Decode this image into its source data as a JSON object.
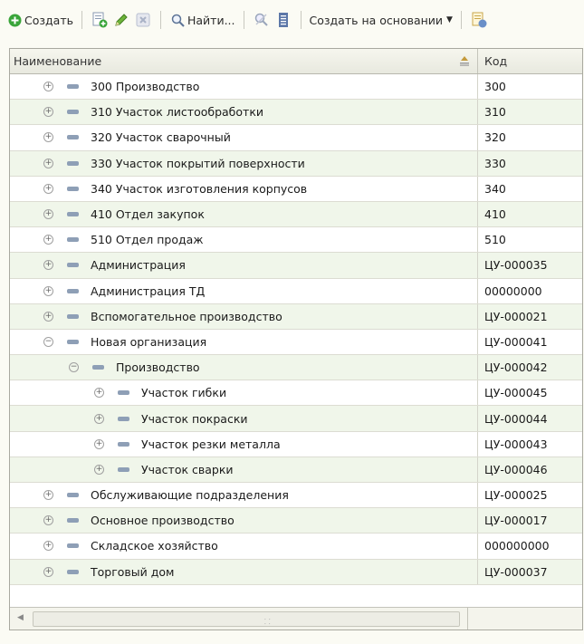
{
  "toolbar": {
    "create_label": "Создать",
    "find_label": "Найти...",
    "create_based_label": "Создать на основании"
  },
  "colors": {
    "accent_green": "#3aa53a",
    "row_alt": "#f0f6ea",
    "folder": "#8e9fb6"
  },
  "table": {
    "columns": {
      "name": "Наименование",
      "code": "Код"
    },
    "rows": [
      {
        "name": "300 Производство",
        "code": "300",
        "level": 0,
        "state": "collapsed"
      },
      {
        "name": "310 Участок листообработки",
        "code": "310",
        "level": 0,
        "state": "collapsed"
      },
      {
        "name": "320 Участок сварочный",
        "code": "320",
        "level": 0,
        "state": "collapsed"
      },
      {
        "name": "330 Участок покрытий поверхности",
        "code": "330",
        "level": 0,
        "state": "collapsed"
      },
      {
        "name": "340 Участок изготовления корпусов",
        "code": "340",
        "level": 0,
        "state": "collapsed"
      },
      {
        "name": "410 Отдел закупок",
        "code": "410",
        "level": 0,
        "state": "collapsed"
      },
      {
        "name": "510 Отдел продаж",
        "code": "510",
        "level": 0,
        "state": "collapsed"
      },
      {
        "name": "Администрация",
        "code": "ЦУ-000035",
        "level": 0,
        "state": "collapsed"
      },
      {
        "name": "Администрация ТД",
        "code": "00000000",
        "level": 0,
        "state": "collapsed"
      },
      {
        "name": "Вспомогательное производство",
        "code": "ЦУ-000021",
        "level": 0,
        "state": "collapsed"
      },
      {
        "name": "Новая организация",
        "code": "ЦУ-000041",
        "level": 0,
        "state": "expanded"
      },
      {
        "name": "Производство",
        "code": "ЦУ-000042",
        "level": 1,
        "state": "expanded"
      },
      {
        "name": "Участок гибки",
        "code": "ЦУ-000045",
        "level": 2,
        "state": "collapsed"
      },
      {
        "name": "Участок покраски",
        "code": "ЦУ-000044",
        "level": 2,
        "state": "collapsed"
      },
      {
        "name": "Участок резки металла",
        "code": "ЦУ-000043",
        "level": 2,
        "state": "collapsed"
      },
      {
        "name": "Участок сварки",
        "code": "ЦУ-000046",
        "level": 2,
        "state": "collapsed"
      },
      {
        "name": "Обслуживающие подразделения",
        "code": "ЦУ-000025",
        "level": 0,
        "state": "collapsed"
      },
      {
        "name": "Основное производство",
        "code": "ЦУ-000017",
        "level": 0,
        "state": "collapsed"
      },
      {
        "name": "Складское хозяйство",
        "code": "000000000",
        "level": 0,
        "state": "collapsed"
      },
      {
        "name": "Торговый дом",
        "code": "ЦУ-000037",
        "level": 0,
        "state": "collapsed"
      }
    ]
  }
}
